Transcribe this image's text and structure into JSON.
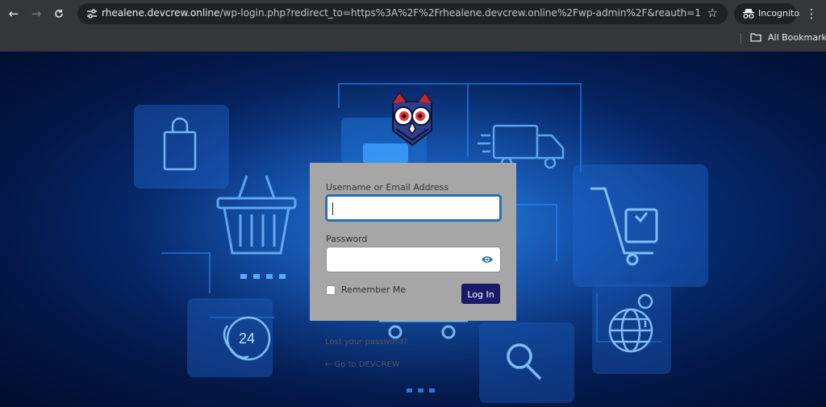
{
  "browser": {
    "url_host": "rhealene.devcrew.online",
    "url_path": "/wp-login.php?redirect_to=https%3A%2F%2Frhealene.devcrew.online%2Fwp-admin%2F&reauth=1",
    "incognito_label": "Incognito",
    "all_bookmarks_label": "All Bookmarks",
    "icons": {
      "back": "back-arrow-icon",
      "forward": "forward-arrow-icon",
      "reload": "reload-icon",
      "site_info": "site-info-icon",
      "bookmark": "star-icon",
      "incognito": "incognito-icon",
      "menu": "menu-dots-icon",
      "folder": "folder-icon"
    }
  },
  "login": {
    "username_label": "Username or Email Address",
    "username_value": "",
    "password_label": "Password",
    "password_value": "",
    "remember_label": "Remember Me",
    "remember_checked": false,
    "submit_label": "Log In",
    "lost_password_label": "Lost your password?",
    "back_link_label": "← Go to DEVCREW"
  },
  "colors": {
    "form_bg": "#a6a6a6",
    "button_bg": "#1a1a6b",
    "focus_border": "#2271b1",
    "page_bg": "#062a6e"
  }
}
